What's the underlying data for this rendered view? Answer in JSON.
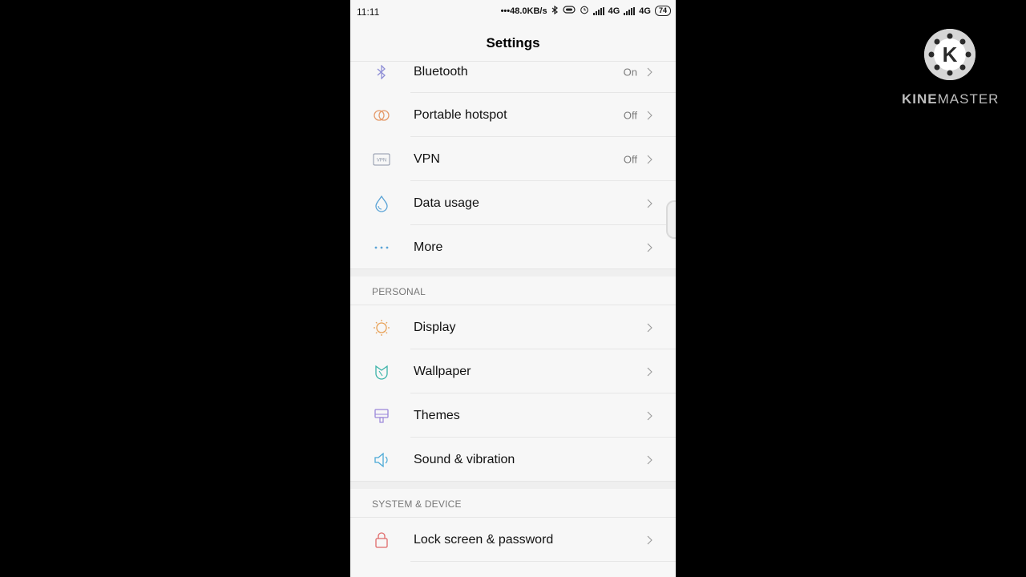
{
  "status": {
    "time": "11:11",
    "network_speed": "•••48.0KB/s",
    "net1": "4G",
    "net2": "4G",
    "battery": "74"
  },
  "appbar": {
    "title": "Settings"
  },
  "rows_top": [
    {
      "label": "Bluetooth",
      "value": "On",
      "icon": "bluetooth-icon"
    },
    {
      "label": "Portable hotspot",
      "value": "Off",
      "icon": "hotspot-icon"
    },
    {
      "label": "VPN",
      "value": "Off",
      "icon": "vpn-icon",
      "icon_text": "VPN"
    },
    {
      "label": "Data usage",
      "value": "",
      "icon": "data-usage-icon"
    },
    {
      "label": "More",
      "value": "",
      "icon": "more-icon"
    }
  ],
  "section_personal": {
    "title": "PERSONAL"
  },
  "rows_personal": [
    {
      "label": "Display",
      "icon": "display-icon"
    },
    {
      "label": "Wallpaper",
      "icon": "wallpaper-icon"
    },
    {
      "label": "Themes",
      "icon": "themes-icon"
    },
    {
      "label": "Sound & vibration",
      "icon": "sound-icon"
    }
  ],
  "section_system": {
    "title": "SYSTEM & DEVICE"
  },
  "rows_system": [
    {
      "label": "Lock screen & password",
      "icon": "lock-icon"
    }
  ],
  "watermark": {
    "brand_a": "KINE",
    "brand_b": "MASTER",
    "logo_letter": "K"
  },
  "colors": {
    "bluetooth": "#8f8fd6",
    "hotspot": "#e59a6a",
    "data": "#5aa3d6",
    "display": "#e8a054",
    "wallpaper": "#3ab3a8",
    "themes": "#9a86d9",
    "sound": "#4aa9d6",
    "lock": "#e06a6a"
  }
}
